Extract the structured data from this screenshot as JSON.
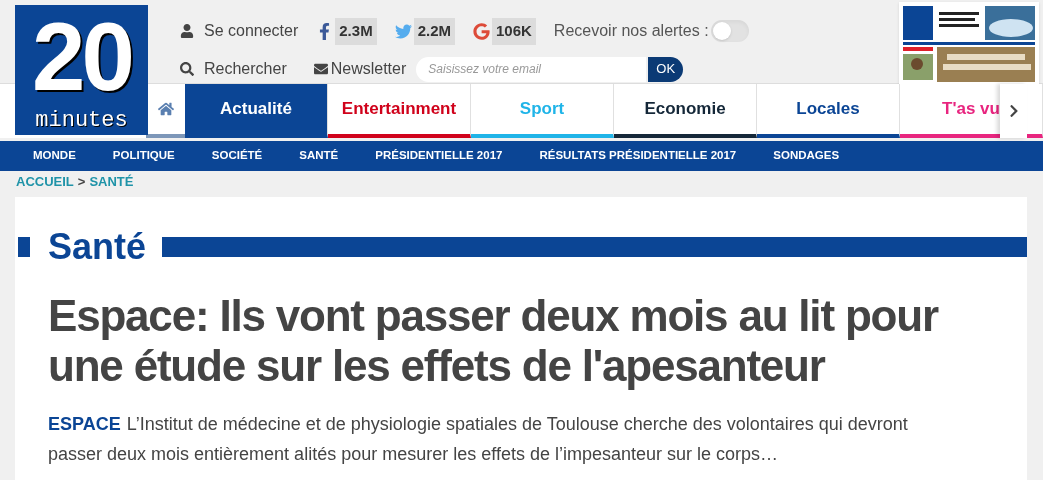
{
  "logo": {
    "digits": "20",
    "word": "minutes"
  },
  "account": {
    "label": "Se connecter"
  },
  "search": {
    "label": "Rechercher"
  },
  "social": [
    {
      "kind": "facebook",
      "count": "2.3M"
    },
    {
      "kind": "twitter",
      "count": "2.2M"
    },
    {
      "kind": "google",
      "count": "106K"
    }
  ],
  "alerts": {
    "label": "Recevoir nos alertes :",
    "on": false
  },
  "newsletter": {
    "label": "Newsletter",
    "placeholder": "Saisissez votre email",
    "button": "OK"
  },
  "tabs": [
    {
      "label": "Actualité",
      "color": "#0b4595",
      "selected": true
    },
    {
      "label": "Entertainment",
      "color": "#d0021b",
      "selected": false
    },
    {
      "label": "Sport",
      "color": "#1fb4e8",
      "selected": false
    },
    {
      "label": "Economie",
      "color": "#142738",
      "selected": false
    },
    {
      "label": "Locales",
      "color": "#0b4595",
      "selected": false
    },
    {
      "label": "T'as vu",
      "color": "#e8257f",
      "selected": false
    }
  ],
  "subnav": [
    "MONDE",
    "POLITIQUE",
    "SOCIÉTÉ",
    "SANTÉ",
    "PRÉSIDENTIELLE 2017",
    "RÉSULTATS PRÉSIDENTIELLE 2017",
    "SONDAGES"
  ],
  "breadcrumb": [
    "ACCUEIL",
    ">",
    "SANTÉ"
  ],
  "section": {
    "title": "Santé"
  },
  "article": {
    "headline": "Espace: Ils vont passer deux mois au lit pour une étude sur les effets de l'apesanteur",
    "kicker": "ESPACE",
    "lead": "L’Institut de médecine et de physiologie spatiales de Toulouse cherche des volontaires qui devront passer deux mois entièrement alités pour mesurer les effets de l’impesanteur sur le corps…"
  }
}
